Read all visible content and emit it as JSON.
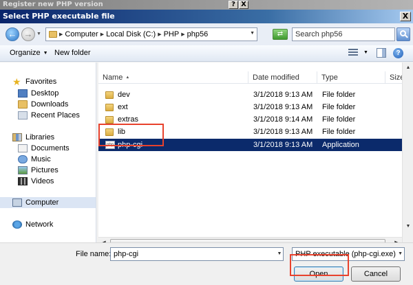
{
  "outer_window": {
    "title": "Register new PHP version",
    "help_glyph": "?",
    "close_glyph": "X"
  },
  "dialog": {
    "title": "Select PHP executable file",
    "close_glyph": "X"
  },
  "address_bar": {
    "breadcrumbs": [
      "Computer",
      "Local Disk (C:)",
      "PHP",
      "php56"
    ],
    "search_placeholder": "Search php56"
  },
  "toolbar": {
    "organize_label": "Organize",
    "new_folder_label": "New folder",
    "help_glyph": "?"
  },
  "nav": {
    "favorites_label": "Favorites",
    "favorites": [
      "Desktop",
      "Downloads",
      "Recent Places"
    ],
    "libraries_label": "Libraries",
    "libraries": [
      "Documents",
      "Music",
      "Pictures",
      "Videos"
    ],
    "computer_label": "Computer",
    "network_label": "Network"
  },
  "columns": {
    "name": "Name",
    "date": "Date modified",
    "type": "Type",
    "size": "Size"
  },
  "files": [
    {
      "name": "dev",
      "date": "3/1/2018 9:13 AM",
      "type": "File folder",
      "icon": "folder-icon"
    },
    {
      "name": "ext",
      "date": "3/1/2018 9:13 AM",
      "type": "File folder",
      "icon": "folder-icon"
    },
    {
      "name": "extras",
      "date": "3/1/2018 9:14 AM",
      "type": "File folder",
      "icon": "folder-icon"
    },
    {
      "name": "lib",
      "date": "3/1/2018 9:13 AM",
      "type": "File folder",
      "icon": "folder-icon"
    },
    {
      "name": "php-cgi",
      "date": "3/1/2018 9:13 AM",
      "type": "Application",
      "icon": "application-icon",
      "selected": true
    }
  ],
  "app_icon_text": "php",
  "bottom": {
    "file_name_label": "File name:",
    "file_name_value": "php-cgi",
    "file_type_filter": "PHP executable (php-cgi.exe)",
    "open_label": "Open",
    "cancel_label": "Cancel"
  },
  "colors": {
    "highlight": "#e8412c",
    "selected_row": "#0b2a6b",
    "title_bar": "#0a246a"
  }
}
